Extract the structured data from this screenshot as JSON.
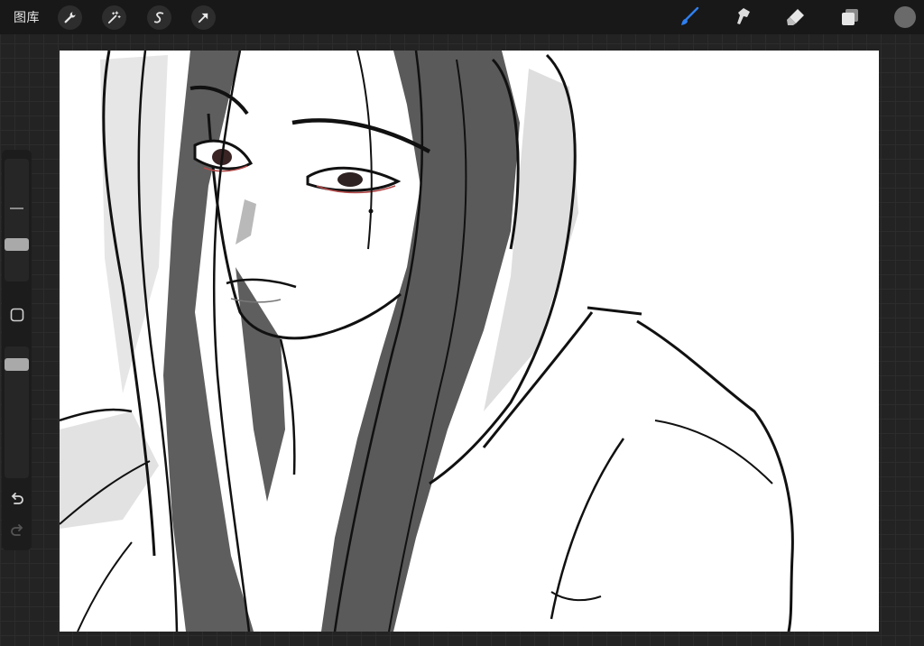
{
  "topbar": {
    "gallery_label": "图库",
    "left_tools": [
      {
        "icon": "wrench-icon",
        "name": "actions"
      },
      {
        "icon": "magic-wand-icon",
        "name": "adjustments"
      },
      {
        "icon": "selection-s-icon",
        "name": "selection"
      },
      {
        "icon": "transform-arrow-icon",
        "name": "transform"
      }
    ],
    "right_tools": [
      {
        "icon": "brush-icon",
        "name": "paint",
        "active": true
      },
      {
        "icon": "smudge-icon",
        "name": "smudge"
      },
      {
        "icon": "eraser-icon",
        "name": "erase"
      },
      {
        "icon": "layers-icon",
        "name": "layers"
      }
    ],
    "current_color": "#6a6a6a",
    "accent_color": "#2f7ff0"
  },
  "sidebar": {
    "brush_size_level": 0.35,
    "opacity_level": 0.05,
    "modify_button_icon": "square-icon",
    "undo_icon": "undo-icon",
    "redo_icon": "redo-icon"
  },
  "canvas": {
    "background": "#ffffff",
    "artwork": "sketch-drawing"
  }
}
